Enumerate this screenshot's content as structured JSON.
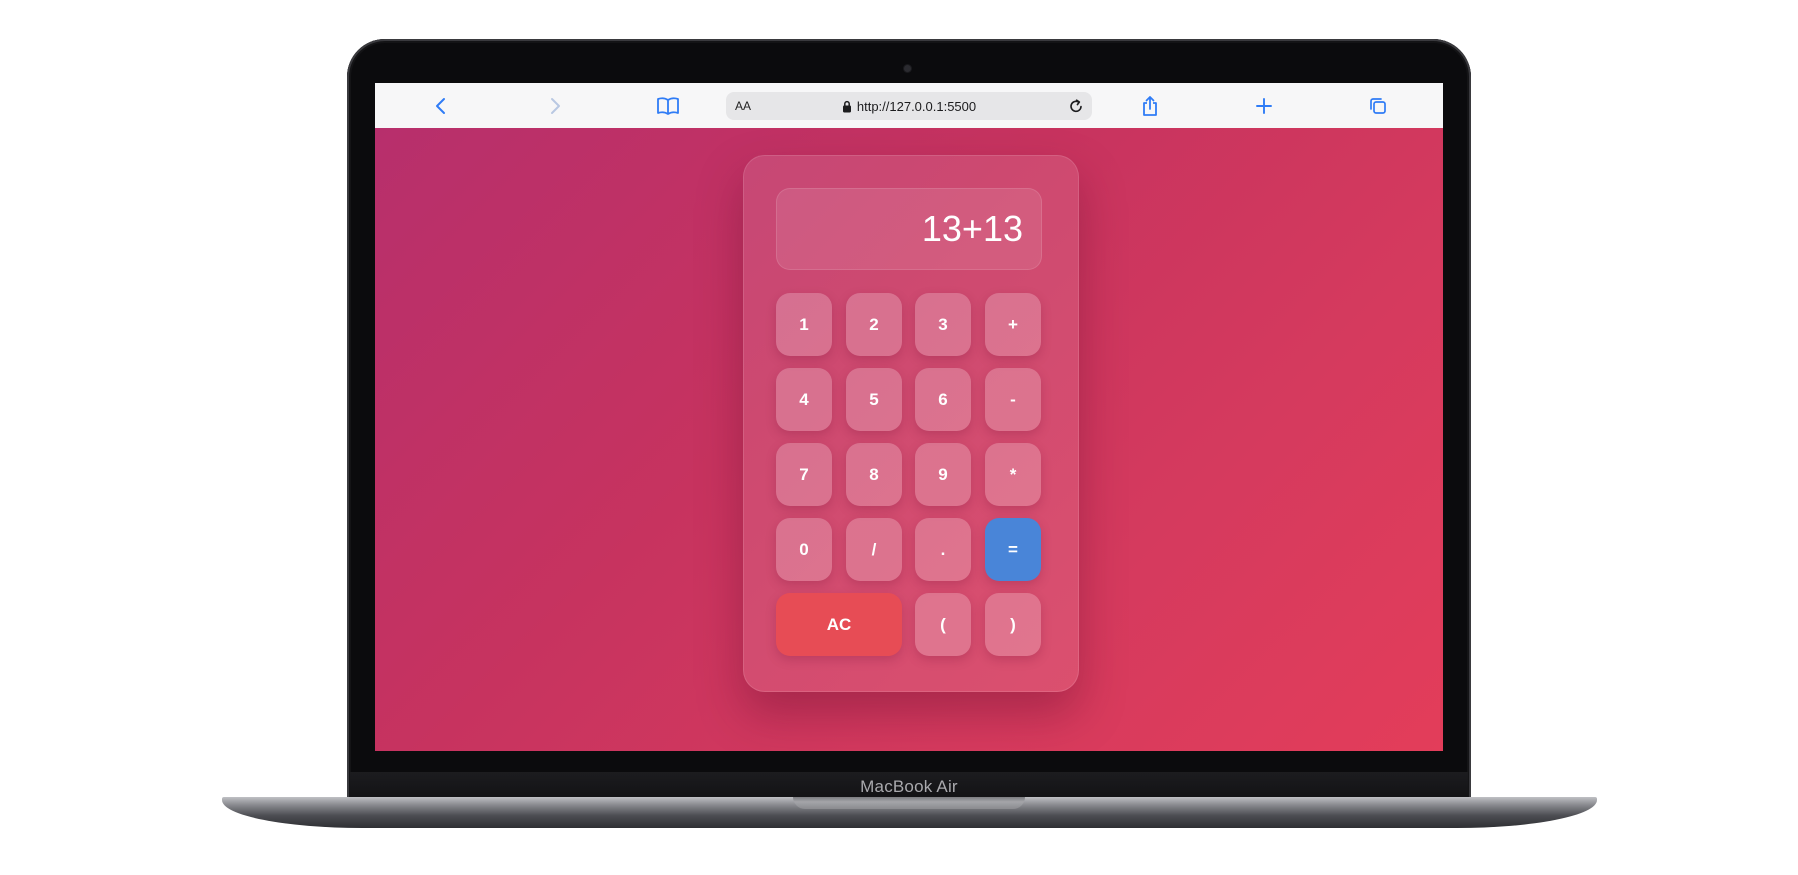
{
  "browser": {
    "text_size_label": "AA",
    "url": "http://127.0.0.1:5500"
  },
  "calculator": {
    "display": "13+13",
    "keys": {
      "k1": "1",
      "k2": "2",
      "k3": "3",
      "plus": "+",
      "k4": "4",
      "k5": "5",
      "k6": "6",
      "minus": "-",
      "k7": "7",
      "k8": "8",
      "k9": "9",
      "multiply": "*",
      "k0": "0",
      "divide": "/",
      "dot": ".",
      "equals": "=",
      "clear": "AC",
      "lparen": "(",
      "rparen": ")"
    }
  },
  "device": {
    "label": "MacBook Air"
  },
  "colors": {
    "accent": "#2f7cf6",
    "equals_key": "#4985d8",
    "clear_key": "#e74c55",
    "page_gradient_start": "#b72f6c",
    "page_gradient_end": "#e33d5a"
  },
  "icons": {
    "back": "chevron-left-icon",
    "forward": "chevron-right-icon",
    "reader": "book-icon",
    "lock": "lock-icon",
    "reload": "reload-icon",
    "share": "share-icon",
    "new_tab": "plus-icon",
    "tabs": "tabs-icon"
  }
}
